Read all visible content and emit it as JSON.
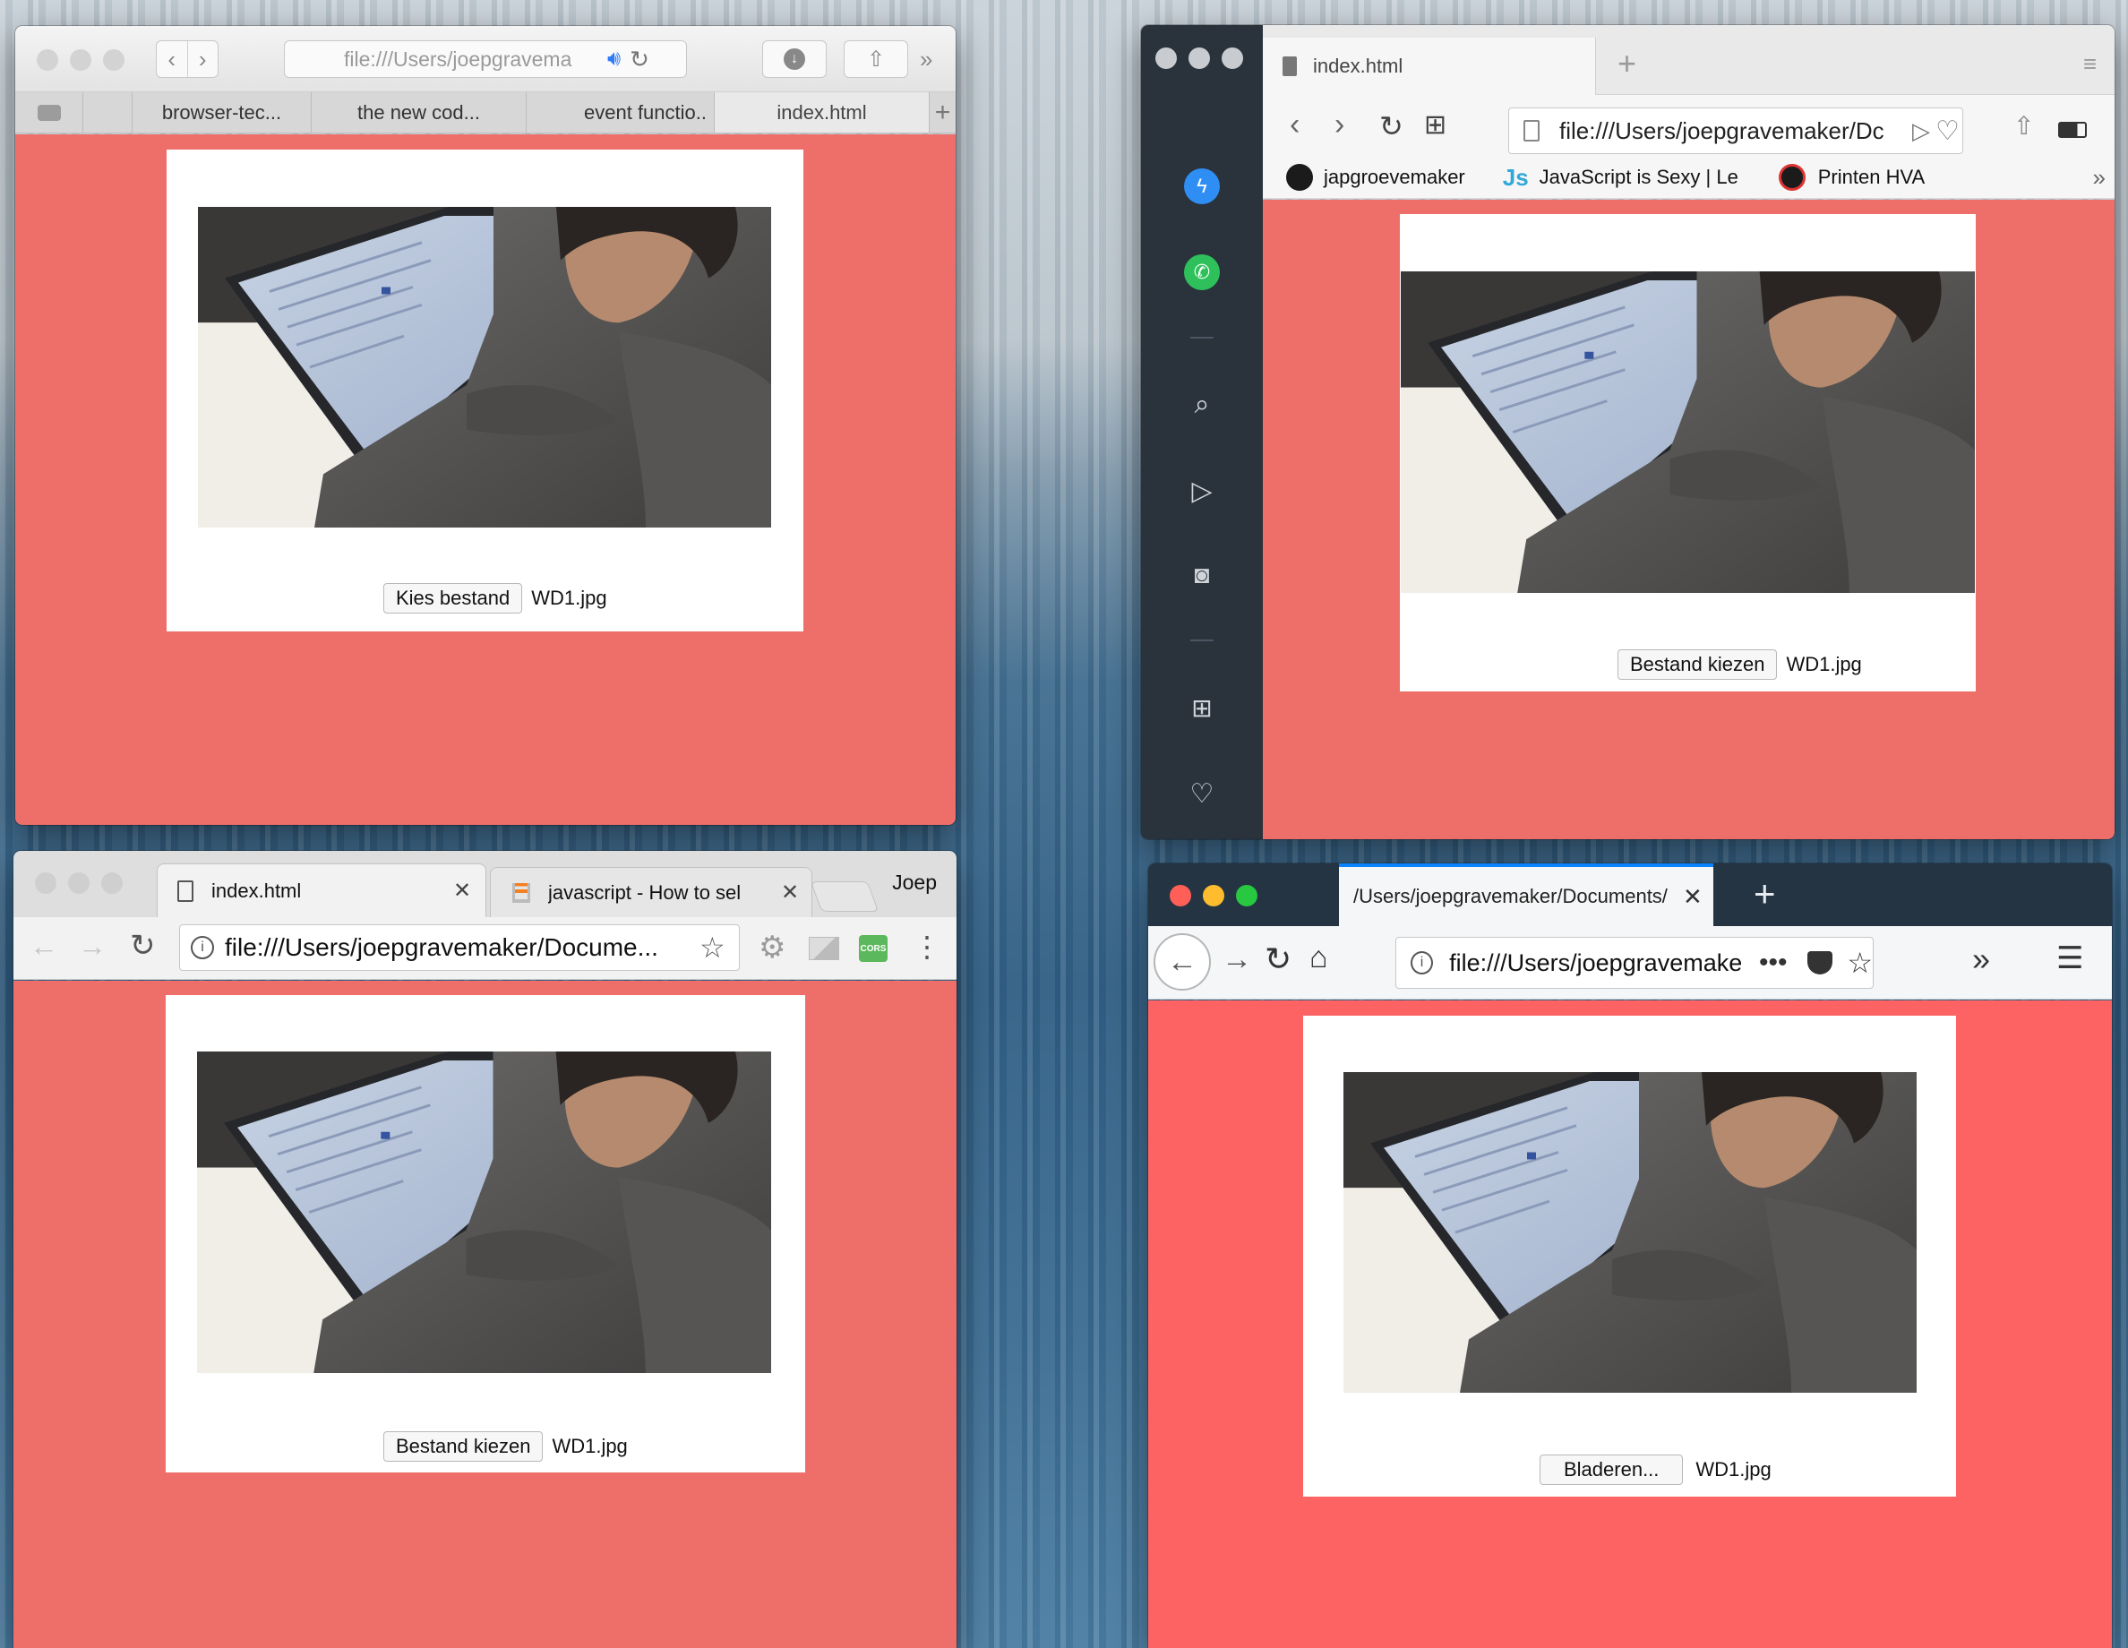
{
  "safari": {
    "url": "file:///Users/joepgravema",
    "tabs": [
      "browser-tec...",
      "the new cod...",
      "event functio..",
      "index.html"
    ],
    "file_button": "Kies bestand",
    "file_name": "WD1.jpg"
  },
  "opera": {
    "tab_title": "index.html",
    "url": "file:///Users/joepgravemaker/Dc",
    "bookmarks": [
      "japgroevemaker",
      "JavaScript is Sexy | Le",
      "Printen HVA"
    ],
    "js_badge": "Js",
    "file_button": "Bestand kiezen",
    "file_name": "WD1.jpg"
  },
  "chrome": {
    "tabs": [
      "index.html",
      "javascript - How to sel"
    ],
    "profile": "Joep",
    "url": "file:///Users/joepgravemaker/Docume...",
    "cors_label": "CORS",
    "file_button": "Bestand kiezen",
    "file_name": "WD1.jpg"
  },
  "firefox": {
    "tab_title": "/Users/joepgravemaker/Documents/",
    "url": "file:///Users/joepgravemake",
    "file_button": "Bladeren...",
    "file_name": "WD1.jpg"
  },
  "colors": {
    "page_bg": "#ee6f6a",
    "firefox_page_bg": "#fe6363",
    "opera_sidebar": "#2a323c",
    "firefox_titlebar": "#243443",
    "mac_close": "#fe5f57",
    "mac_min": "#febc2e",
    "mac_max": "#28c840"
  }
}
